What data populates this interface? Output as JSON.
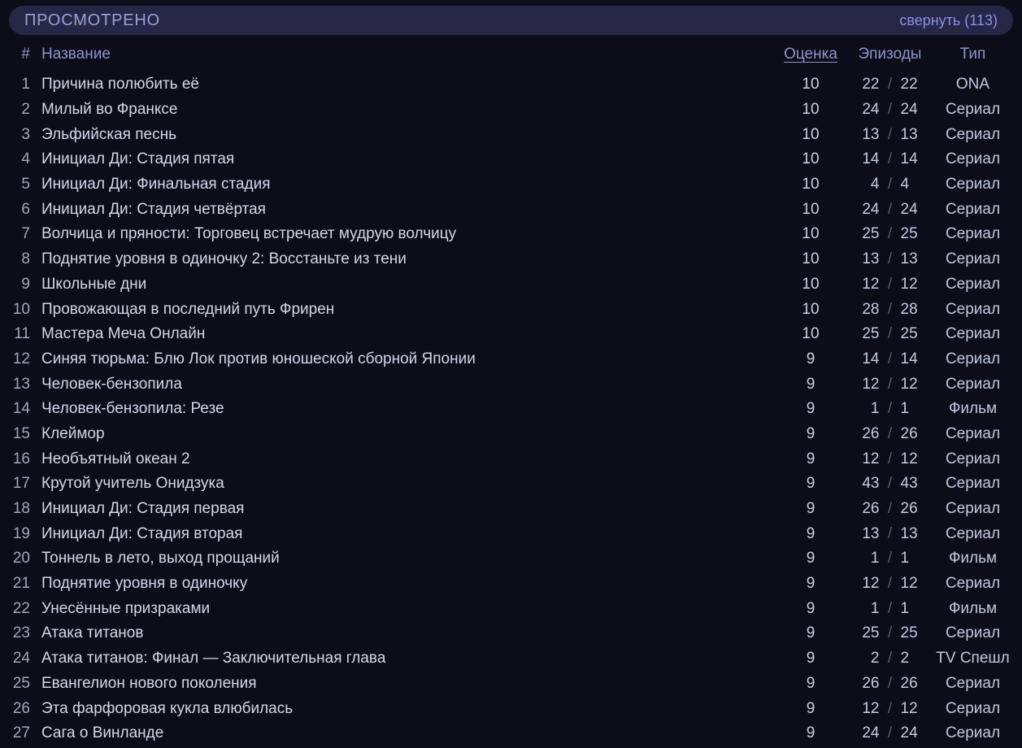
{
  "panel": {
    "title": "ПРОСМОТРЕНО",
    "collapse_label": "свернуть (113)",
    "count": 113
  },
  "table": {
    "columns": {
      "index": "#",
      "title": "Название",
      "score": "Оценка",
      "episodes": "Эпизоды",
      "type": "Тип"
    },
    "sorted_column": "Оценка",
    "episodes_separator": "/",
    "rows": [
      {
        "index": "1",
        "title": "Причина полюбить её",
        "score": "10",
        "watched": "22",
        "total": "22",
        "type": "ONA"
      },
      {
        "index": "2",
        "title": "Милый во Франксе",
        "score": "10",
        "watched": "24",
        "total": "24",
        "type": "Сериал"
      },
      {
        "index": "3",
        "title": "Эльфийская песнь",
        "score": "10",
        "watched": "13",
        "total": "13",
        "type": "Сериал"
      },
      {
        "index": "4",
        "title": "Инициал Ди: Стадия пятая",
        "score": "10",
        "watched": "14",
        "total": "14",
        "type": "Сериал"
      },
      {
        "index": "5",
        "title": "Инициал Ди: Финальная стадия",
        "score": "10",
        "watched": "4",
        "total": "4",
        "type": "Сериал"
      },
      {
        "index": "6",
        "title": "Инициал Ди: Стадия четвёртая",
        "score": "10",
        "watched": "24",
        "total": "24",
        "type": "Сериал"
      },
      {
        "index": "7",
        "title": "Волчица и пряности: Торговец встречает мудрую волчицу",
        "score": "10",
        "watched": "25",
        "total": "25",
        "type": "Сериал"
      },
      {
        "index": "8",
        "title": "Поднятие уровня в одиночку 2: Восстаньте из тени",
        "score": "10",
        "watched": "13",
        "total": "13",
        "type": "Сериал"
      },
      {
        "index": "9",
        "title": "Школьные дни",
        "score": "10",
        "watched": "12",
        "total": "12",
        "type": "Сериал"
      },
      {
        "index": "10",
        "title": "Провожающая в последний путь Фрирен",
        "score": "10",
        "watched": "28",
        "total": "28",
        "type": "Сериал"
      },
      {
        "index": "11",
        "title": "Мастера Меча Онлайн",
        "score": "10",
        "watched": "25",
        "total": "25",
        "type": "Сериал"
      },
      {
        "index": "12",
        "title": "Синяя тюрьма: Блю Лок против юношеской сборной Японии",
        "score": "9",
        "watched": "14",
        "total": "14",
        "type": "Сериал"
      },
      {
        "index": "13",
        "title": "Человек-бензопила",
        "score": "9",
        "watched": "12",
        "total": "12",
        "type": "Сериал"
      },
      {
        "index": "14",
        "title": "Человек-бензопила: Резе",
        "score": "9",
        "watched": "1",
        "total": "1",
        "type": "Фильм"
      },
      {
        "index": "15",
        "title": "Клеймор",
        "score": "9",
        "watched": "26",
        "total": "26",
        "type": "Сериал"
      },
      {
        "index": "16",
        "title": "Необъятный океан 2",
        "score": "9",
        "watched": "12",
        "total": "12",
        "type": "Сериал"
      },
      {
        "index": "17",
        "title": "Крутой учитель Онидзука",
        "score": "9",
        "watched": "43",
        "total": "43",
        "type": "Сериал"
      },
      {
        "index": "18",
        "title": "Инициал Ди: Стадия первая",
        "score": "9",
        "watched": "26",
        "total": "26",
        "type": "Сериал"
      },
      {
        "index": "19",
        "title": "Инициал Ди: Стадия вторая",
        "score": "9",
        "watched": "13",
        "total": "13",
        "type": "Сериал"
      },
      {
        "index": "20",
        "title": "Тоннель в лето, выход прощаний",
        "score": "9",
        "watched": "1",
        "total": "1",
        "type": "Фильм"
      },
      {
        "index": "21",
        "title": "Поднятие уровня в одиночку",
        "score": "9",
        "watched": "12",
        "total": "12",
        "type": "Сериал"
      },
      {
        "index": "22",
        "title": "Унесённые призраками",
        "score": "9",
        "watched": "1",
        "total": "1",
        "type": "Фильм"
      },
      {
        "index": "23",
        "title": "Атака титанов",
        "score": "9",
        "watched": "25",
        "total": "25",
        "type": "Сериал"
      },
      {
        "index": "24",
        "title": "Атака титанов: Финал — Заключительная глава",
        "score": "9",
        "watched": "2",
        "total": "2",
        "type": "TV Спешл"
      },
      {
        "index": "25",
        "title": "Евангелион нового поколения",
        "score": "9",
        "watched": "26",
        "total": "26",
        "type": "Сериал"
      },
      {
        "index": "26",
        "title": "Эта фарфоровая кукла влюбилась",
        "score": "9",
        "watched": "12",
        "total": "12",
        "type": "Сериал"
      },
      {
        "index": "27",
        "title": "Сага о Винланде",
        "score": "9",
        "watched": "24",
        "total": "24",
        "type": "Сериал"
      }
    ]
  },
  "colors": {
    "page_background": "#0c0d18",
    "header_bar_background": "#262747",
    "header_title": "#9aa0d8",
    "collapse_link": "#8b90e4",
    "column_header": "#8f94ce",
    "row_index": "#a3a5bd",
    "row_title": "#d5d7ea",
    "episode_separator": "#585c74"
  }
}
